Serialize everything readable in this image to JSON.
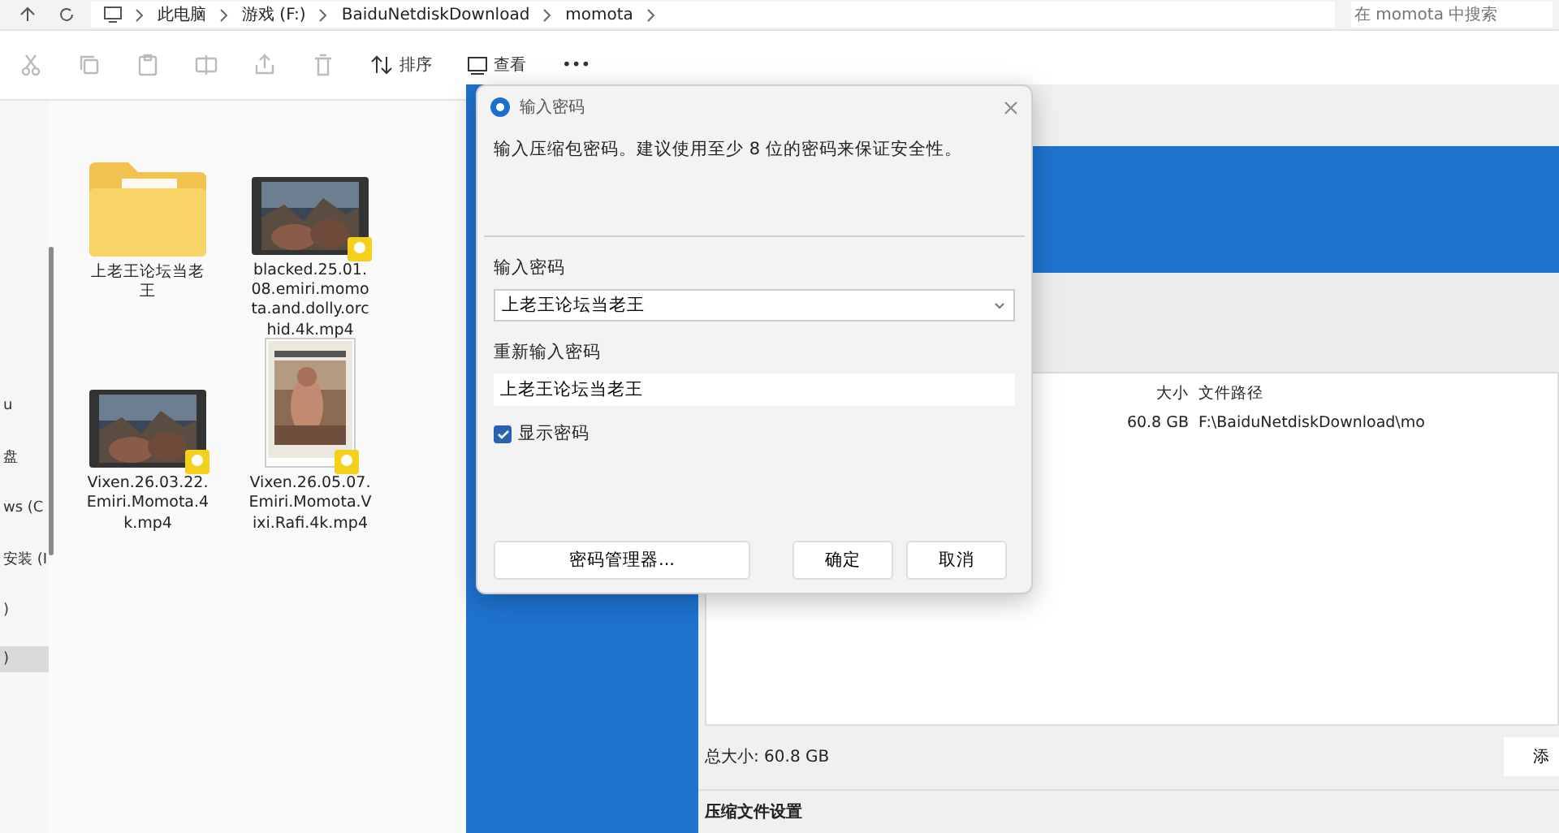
{
  "explorer": {
    "breadcrumb": [
      "此电脑",
      "游戏 (F:)",
      "BaiduNetdiskDownload",
      "momota"
    ],
    "search": {
      "placeholder": "在 momota 中搜索"
    },
    "toolbar": {
      "sort": "排序",
      "view": "查看",
      "more": "•••"
    },
    "sidebar": {
      "items": [
        {
          "label": "u",
          "selected": false
        },
        {
          "label": "盘",
          "selected": false
        },
        {
          "label": "ws (C",
          "selected": false
        },
        {
          "label": "安装 (I",
          "selected": false
        },
        {
          "label": ")",
          "selected": false
        },
        {
          "label": ")",
          "selected": true
        }
      ]
    },
    "files": [
      {
        "kind": "folder",
        "name": "上老王论坛当老王"
      },
      {
        "kind": "video",
        "name": "blacked.25.01.08.emiri.momota.and.dolly.orchid.4k.mp4"
      },
      {
        "kind": "video",
        "name": "Vixen.26.03.22.Emiri.Momota.4k.mp4"
      },
      {
        "kind": "poster",
        "name": "Vixen.26.05.07.Emiri.Momota.Vixi.Rafi.4k.mp4"
      }
    ]
  },
  "archiver": {
    "columns": [
      "大小",
      "文件路径"
    ],
    "rows": [
      {
        "size": "60.8 GB",
        "path": "F:\\BaiduNetdiskDownload\\mo"
      }
    ],
    "total": "总大小: 60.8 GB",
    "add_button": "添",
    "settings_heading": "压缩文件设置"
  },
  "dialog": {
    "title": "输入密码",
    "message": "输入压缩包密码。建议使用至少 8 位的密码来保证安全性。",
    "password_label": "输入密码",
    "password": "上老王论坛当老王",
    "confirm_label": "重新输入密码",
    "confirm": "上老王论坛当老王",
    "show_password": {
      "label": "显示密码",
      "checked": true
    },
    "buttons": [
      "密码管理器...",
      "确定",
      "取消"
    ]
  }
}
